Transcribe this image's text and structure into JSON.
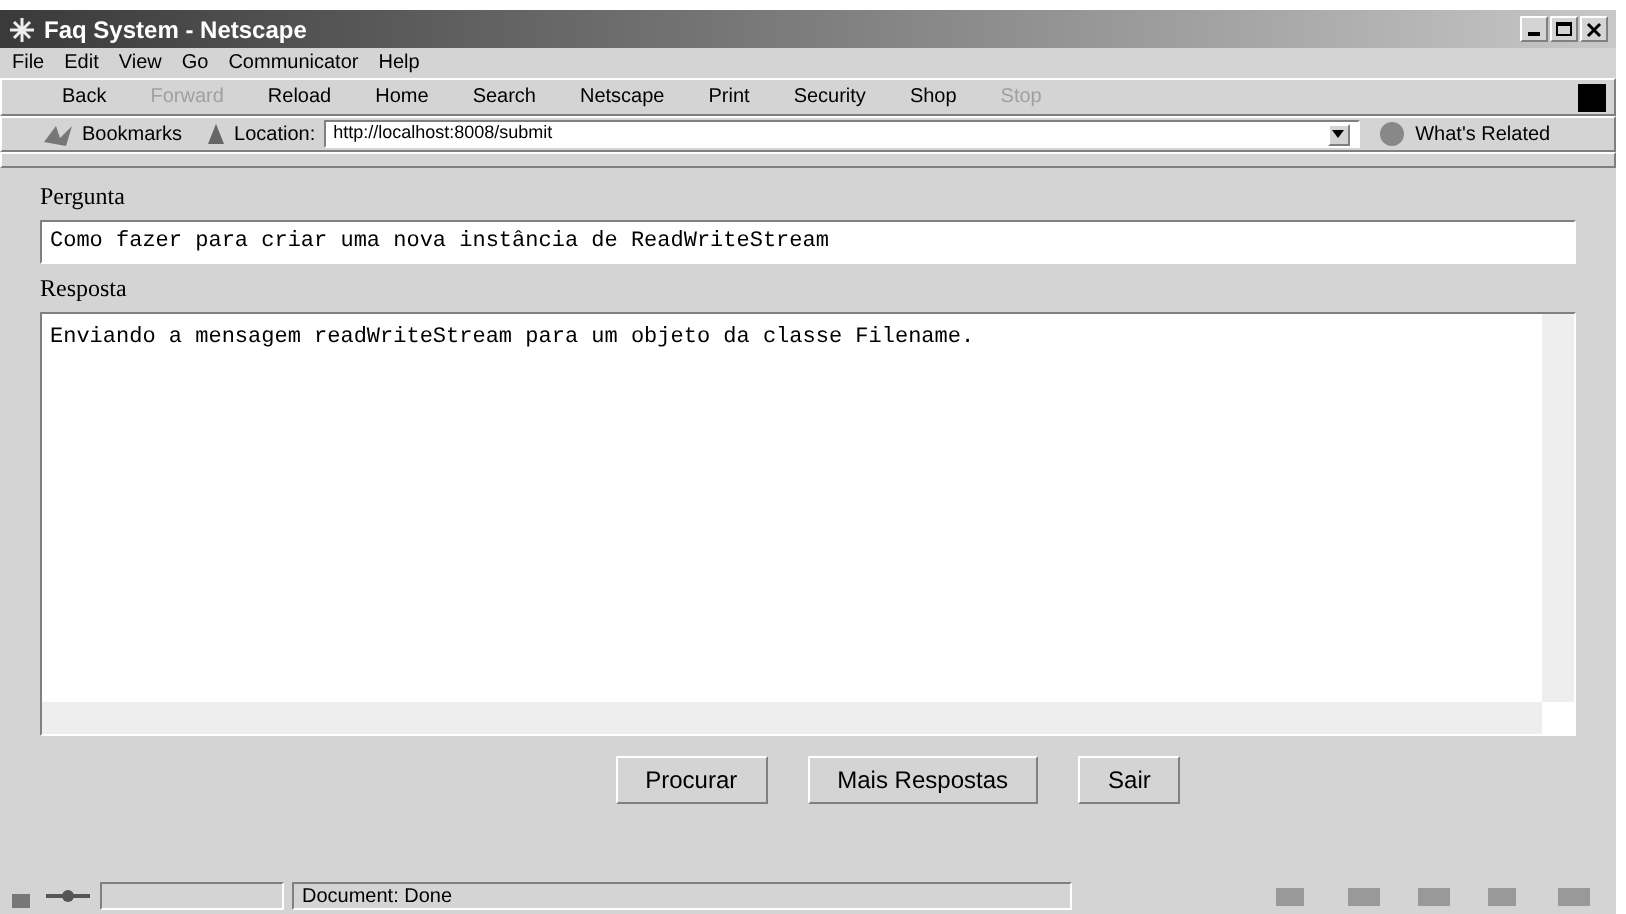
{
  "window": {
    "title": "Faq System - Netscape"
  },
  "menu": [
    "File",
    "Edit",
    "View",
    "Go",
    "Communicator",
    "Help"
  ],
  "toolbar": [
    {
      "label": "Back",
      "disabled": false
    },
    {
      "label": "Forward",
      "disabled": true
    },
    {
      "label": "Reload",
      "disabled": false
    },
    {
      "label": "Home",
      "disabled": false
    },
    {
      "label": "Search",
      "disabled": false
    },
    {
      "label": "Netscape",
      "disabled": false
    },
    {
      "label": "Print",
      "disabled": false
    },
    {
      "label": "Security",
      "disabled": false
    },
    {
      "label": "Shop",
      "disabled": false
    },
    {
      "label": "Stop",
      "disabled": true
    }
  ],
  "location_bar": {
    "bookmarks": "Bookmarks",
    "location_label": "Location:",
    "url": "http://localhost:8008/submit",
    "related": "What's Related"
  },
  "form": {
    "question_label": "Pergunta",
    "question": "Como fazer para criar uma nova instância de ReadWriteStream",
    "answer_label": "Resposta",
    "answer": "Enviando a mensagem readWriteStream para um objeto da classe Filename."
  },
  "buttons": [
    "Procurar",
    "Mais Respostas",
    "Sair"
  ],
  "status_bar": {
    "text": "Document: Done"
  }
}
